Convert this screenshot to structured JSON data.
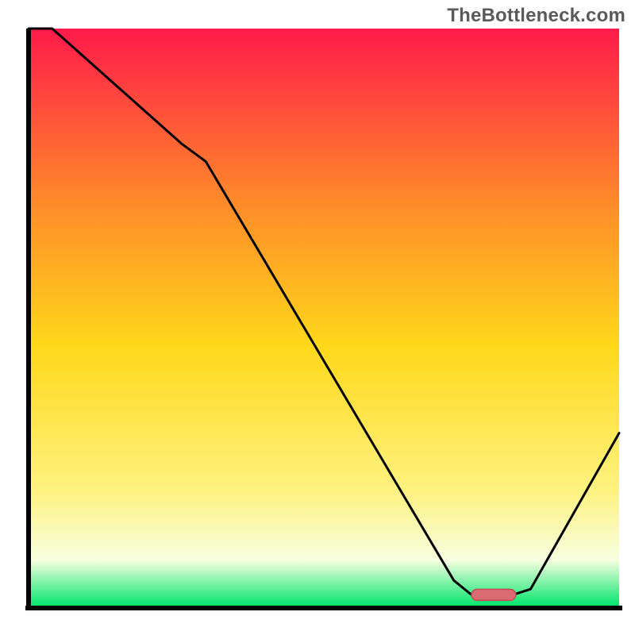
{
  "watermark": "TheBottleneck.com",
  "colors": {
    "axis": "#000000",
    "curve": "#000000",
    "marker_fill": "#db6b72",
    "marker_stroke": "#c74a52",
    "gradient_top": "#ff1a4a",
    "gradient_upper_mid": "#ff8a2a",
    "gradient_mid": "#ffd81a",
    "gradient_lower_mid": "#fff280",
    "gradient_pale": "#f6ffe0",
    "gradient_bottom": "#00e66a"
  },
  "chart_data": {
    "type": "line",
    "title": "",
    "xlabel": "",
    "ylabel": "",
    "xlim": [
      0,
      100
    ],
    "ylim": [
      0,
      100
    ],
    "x": [
      0,
      4,
      26,
      30,
      72,
      75,
      82,
      85,
      100
    ],
    "values": [
      100,
      100,
      80,
      77,
      4.5,
      2,
      2,
      3,
      30
    ],
    "optimum_marker": {
      "x_start": 75,
      "x_end": 82.5,
      "y": 2
    },
    "notes": "X axis is an unlabeled normalized scale; Y axis is an unlabeled normalized bottleneck-severity scale where 100 = worst (red) and 0 = best (green). The curve drops from the top-left, flattens at the marked optimum near x≈75–82, then rises toward the right edge. Values are estimated from the plotted curve against the background gradient; no numeric tick labels are shown."
  }
}
